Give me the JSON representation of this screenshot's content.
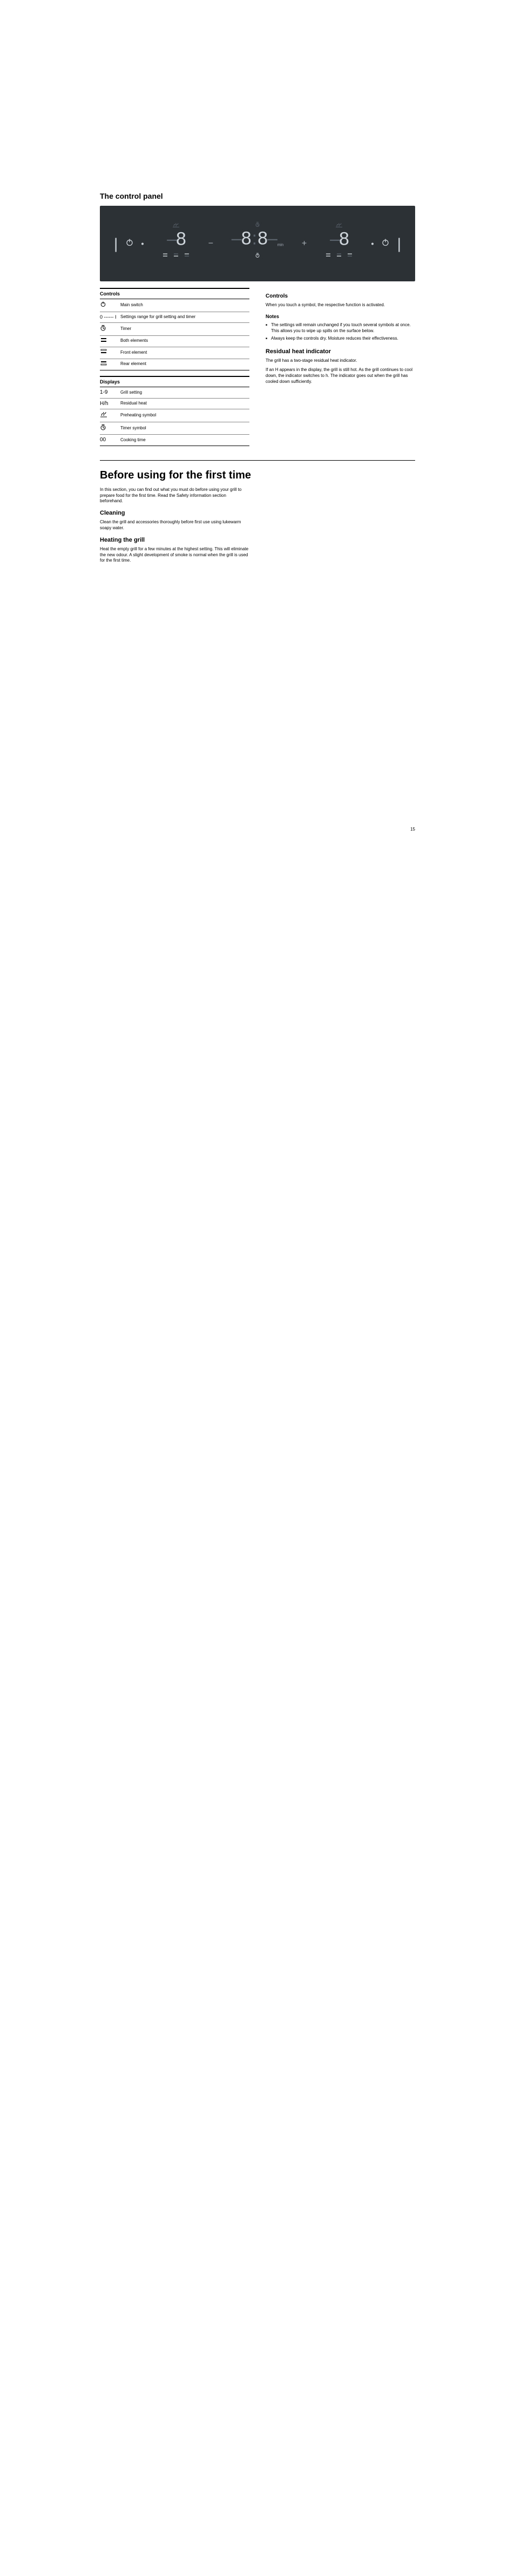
{
  "headings": {
    "control_panel": "The control panel",
    "before_using": "Before using for the first time"
  },
  "left_column": {
    "controls_table": {
      "header": "Controls",
      "rows": [
        {
          "symbol": "power-icon",
          "label": "Main switch"
        },
        {
          "symbol": "settings-range",
          "label": "Settings range for grill setting and timer"
        },
        {
          "symbol": "timer-icon",
          "label": "Timer"
        },
        {
          "symbol": "both-bars-icon",
          "label": "Both elements"
        },
        {
          "symbol": "front-bar-icon",
          "label": "Front element"
        },
        {
          "symbol": "rear-bar-icon",
          "label": "Rear element"
        }
      ]
    },
    "displays_table": {
      "header": "Displays",
      "rows": [
        {
          "symbol": "grill-num",
          "label": "Grill setting"
        },
        {
          "symbol": "residual-heat",
          "label": "Residual heat"
        },
        {
          "symbol": "preheat-symbol",
          "label": "Preheating symbol"
        },
        {
          "symbol": "timer-symbol",
          "label": "Timer symbol"
        },
        {
          "symbol": "cooking-time",
          "label": "Cooking time"
        }
      ]
    },
    "symbol_text": {
      "grill_num_a": "1",
      "grill_num_b": "9",
      "residual": "H/h",
      "cooking_time": "00"
    }
  },
  "right_column": {
    "controls_h": "Controls",
    "controls_p1": "When you touch a symbol, the respective function is activated.",
    "notes_h": "Notes",
    "notes": [
      "The settings will remain unchanged if you touch several symbols at once. This allows you to wipe up spills on the surface below.",
      "Always keep the controls dry. Moisture reduces their effectiveness."
    ],
    "residual_h": "Residual heat indicator",
    "residual_p1": "The grill has a two-stage residual heat indicator.",
    "residual_p2": "If an H appears in the display, the grill is still hot. As the grill continues to cool down, the indicator switches to h. The indicator goes out when the grill has cooled down sufficiently."
  },
  "section2": {
    "intro": "In this section, you can find out what you must do before using your grill to prepare food for the first time. Read the Safety information section beforehand.",
    "cleaning_h": "Cleaning",
    "cleaning_p": "Clean the grill and accessories thoroughly before first use using lukewarm soapy water.",
    "heating_h": "Heating the grill",
    "heating_p": "Heat the empty grill for a few minutes at the highest setting. This will eliminate the new odour. A slight development of smoke is normal when the grill is used for the first time."
  },
  "panel_labels": {
    "min": "min"
  },
  "page_number": "15"
}
